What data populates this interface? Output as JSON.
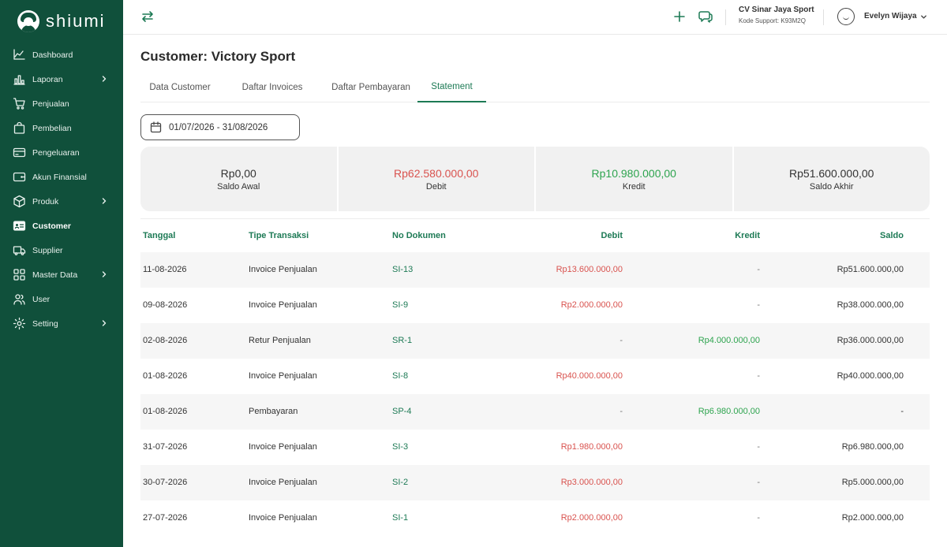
{
  "app": {
    "name": "shiumi"
  },
  "sidebar": {
    "items": [
      {
        "label": "Dashboard",
        "icon": "chart-line-icon",
        "chevron": false,
        "active": false
      },
      {
        "label": "Laporan",
        "icon": "bar-chart-icon",
        "chevron": true,
        "active": false
      },
      {
        "label": "Penjualan",
        "icon": "cart-icon",
        "chevron": false,
        "active": false
      },
      {
        "label": "Pembelian",
        "icon": "shopping-bag-icon",
        "chevron": false,
        "active": false
      },
      {
        "label": "Pengeluaran",
        "icon": "card-icon",
        "chevron": false,
        "active": false
      },
      {
        "label": "Akun Finansial",
        "icon": "wallet-icon",
        "chevron": false,
        "active": false
      },
      {
        "label": "Produk",
        "icon": "box-icon",
        "chevron": true,
        "active": false
      },
      {
        "label": "Customer",
        "icon": "id-card-icon",
        "chevron": false,
        "active": true
      },
      {
        "label": "Supplier",
        "icon": "truck-icon",
        "chevron": false,
        "active": false
      },
      {
        "label": "Master Data",
        "icon": "grid-icon",
        "chevron": true,
        "active": false
      },
      {
        "label": "User",
        "icon": "users-icon",
        "chevron": false,
        "active": false
      },
      {
        "label": "Setting",
        "icon": "gear-icon",
        "chevron": true,
        "active": false
      }
    ]
  },
  "topbar": {
    "company": "CV Sinar Jaya Sport",
    "support": "Kode Support: K93M2Q",
    "user": "Evelyn Wijaya"
  },
  "page": {
    "title": "Customer: Victory Sport",
    "tabs": [
      "Data Customer",
      "Daftar Invoices",
      "Daftar Pembayaran",
      "Statement"
    ],
    "active_tab": "Statement",
    "date_range": "01/07/2026 - 31/08/2026"
  },
  "summary": [
    {
      "value": "Rp0,00",
      "label": "Saldo Awal",
      "color": "#333333"
    },
    {
      "value": "Rp62.580.000,00",
      "label": "Debit",
      "color": "#d9534f"
    },
    {
      "value": "Rp10.980.000,00",
      "label": "Kredit",
      "color": "#2ea44f"
    },
    {
      "value": "Rp51.600.000,00",
      "label": "Saldo Akhir",
      "color": "#333333"
    }
  ],
  "table": {
    "headers": {
      "date": "Tanggal",
      "type": "Tipe Transaksi",
      "doc": "No Dokumen",
      "debit": "Debit",
      "credit": "Kredit",
      "saldo": "Saldo"
    },
    "rows": [
      {
        "date": "11-08-2026",
        "type": "Invoice Penjualan",
        "doc": "SI-13",
        "debit": "Rp13.600.000,00",
        "credit": "-",
        "saldo": "Rp51.600.000,00"
      },
      {
        "date": "09-08-2026",
        "type": "Invoice Penjualan",
        "doc": "SI-9",
        "debit": "Rp2.000.000,00",
        "credit": "-",
        "saldo": "Rp38.000.000,00"
      },
      {
        "date": "02-08-2026",
        "type": "Retur Penjualan",
        "doc": "SR-1",
        "debit": "-",
        "credit": "Rp4.000.000,00",
        "saldo": "Rp36.000.000,00"
      },
      {
        "date": "01-08-2026",
        "type": "Invoice Penjualan",
        "doc": "SI-8",
        "debit": "Rp40.000.000,00",
        "credit": "-",
        "saldo": "Rp40.000.000,00"
      },
      {
        "date": "01-08-2026",
        "type": "Pembayaran",
        "doc": "SP-4",
        "debit": "-",
        "credit": "Rp6.980.000,00",
        "saldo": "-"
      },
      {
        "date": "31-07-2026",
        "type": "Invoice Penjualan",
        "doc": "SI-3",
        "debit": "Rp1.980.000,00",
        "credit": "-",
        "saldo": "Rp6.980.000,00"
      },
      {
        "date": "30-07-2026",
        "type": "Invoice Penjualan",
        "doc": "SI-2",
        "debit": "Rp3.000.000,00",
        "credit": "-",
        "saldo": "Rp5.000.000,00"
      },
      {
        "date": "27-07-2026",
        "type": "Invoice Penjualan",
        "doc": "SI-1",
        "debit": "Rp2.000.000,00",
        "credit": "-",
        "saldo": "Rp2.000.000,00"
      }
    ]
  },
  "colors": {
    "sidebar": "#10503b",
    "accent": "#1d7a55",
    "debit": "#d9534f",
    "credit": "#2ea44f"
  }
}
